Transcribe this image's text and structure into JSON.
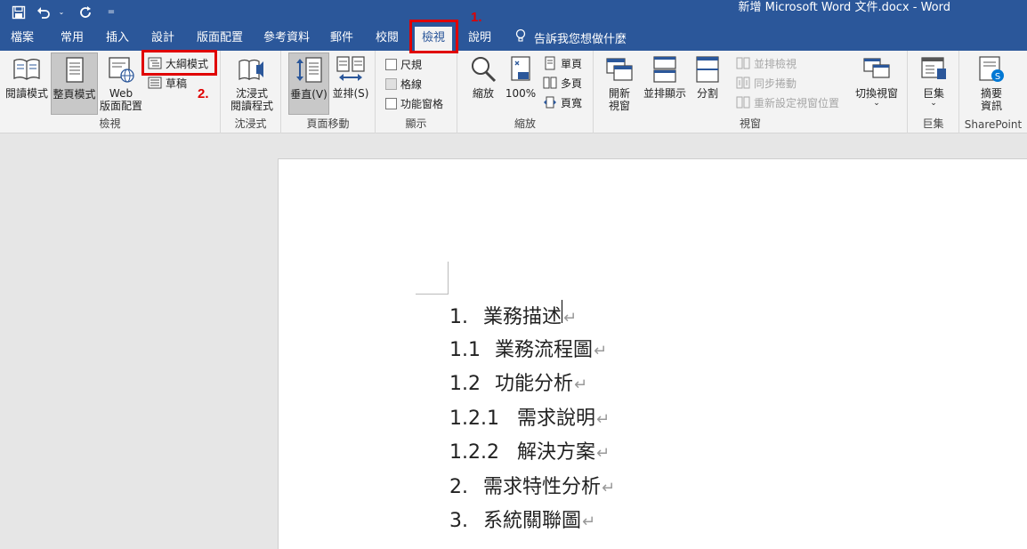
{
  "window": {
    "title": "新增 Microsoft Word 文件.docx  -  Word"
  },
  "quick_access": {
    "icons": [
      "save-icon",
      "undo-icon",
      "redo-icon",
      "customize-icon"
    ]
  },
  "tabs": [
    {
      "label": "檔案"
    },
    {
      "label": "常用"
    },
    {
      "label": "插入"
    },
    {
      "label": "設計"
    },
    {
      "label": "版面配置"
    },
    {
      "label": "參考資料"
    },
    {
      "label": "郵件"
    },
    {
      "label": "校閱"
    },
    {
      "label": "檢視",
      "active": true
    },
    {
      "label": "說明"
    }
  ],
  "tell_me": "告訴我您想做什麼",
  "ribbon": {
    "views": {
      "label": "檢視",
      "read_mode": "閱讀模式",
      "print_layout": "整頁模式",
      "web_layout_1": "Web",
      "web_layout_2": "版面配置",
      "outline": "大綱模式",
      "draft": "草稿"
    },
    "immersive": {
      "label": "沈浸式",
      "reader_1": "沈浸式",
      "reader_2": "閱讀程式"
    },
    "page_movement": {
      "label": "頁面移動",
      "vertical": "垂直(V)",
      "side_by_side": "並排(S)"
    },
    "show": {
      "label": "顯示",
      "ruler": "尺規",
      "gridlines": "格線",
      "nav_pane": "功能窗格",
      "ruler_checked": false,
      "gridlines_checked": false,
      "nav_pane_checked": false
    },
    "zoom": {
      "label": "縮放",
      "zoom": "縮放",
      "percent": "100%",
      "one_page": "單頁",
      "multiple_pages": "多頁",
      "page_width": "頁寬"
    },
    "window": {
      "label": "視窗",
      "new_window_1": "開新",
      "new_window_2": "視窗",
      "arrange_all": "並排顯示",
      "split": "分割",
      "view_side_by_side": "並排檢視",
      "sync_scroll": "同步捲動",
      "reset_position": "重新設定視窗位置",
      "switch_windows": "切換視窗"
    },
    "macros": {
      "label": "巨集",
      "macros": "巨集"
    },
    "sharepoint": {
      "label": "SharePoint",
      "properties_1": "摘要",
      "properties_2": "資訊"
    }
  },
  "annotations": {
    "step1": "1.",
    "step2": "2."
  },
  "document": {
    "lines": [
      {
        "num": "1.",
        "text": "業務描述",
        "cursor": true
      },
      {
        "num": "1.1",
        "text": "業務流程圖"
      },
      {
        "num": "1.2",
        "text": "功能分析"
      },
      {
        "num": "1.2.1",
        "text": "需求說明"
      },
      {
        "num": "1.2.2",
        "text": "解決方案"
      },
      {
        "num": "2.",
        "text": "需求特性分析"
      },
      {
        "num": "3.",
        "text": "系統關聯圖"
      }
    ],
    "para_mark": "↵"
  },
  "colors": {
    "brand_blue": "#2b579a",
    "annotation_red": "#e00000",
    "ribbon_bg": "#f3f3f3"
  }
}
